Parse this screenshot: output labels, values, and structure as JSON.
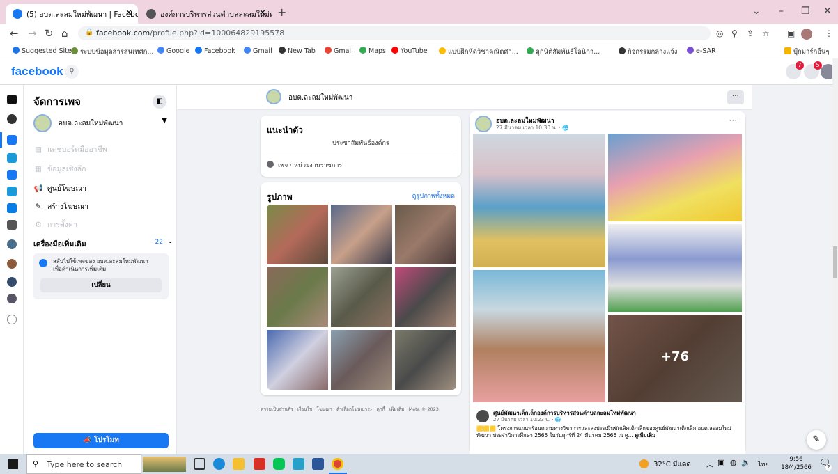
{
  "browser": {
    "tabs": [
      {
        "title": "(5) อบต.ละลมใหม่พัฒนา | Facebook",
        "active": true
      },
      {
        "title": "องค์การบริหารส่วนตำบลละลมใหม่พัฒ",
        "active": false
      }
    ],
    "url_host": "facebook.com",
    "url_path": "/profile.php?id=100064829195578",
    "bookmarks": [
      "Suggested Sites",
      "ระบบข้อมูลสารสนเทศก...",
      "Google",
      "Facebook",
      "Gmail",
      "New Tab",
      "Gmail",
      "Maps",
      "YouTube",
      "แบบฝึกหัดวิชาคณิตศา...",
      "ลูกนิติสัมพันธ์โอนิกา...",
      "กิจกรรมกลางแจ้ง",
      "e-SAR",
      "บุ๊กมาร์กอื่นๆ"
    ]
  },
  "fb": {
    "logo": "facebook",
    "notif_badges": [
      "7",
      "5"
    ]
  },
  "panel": {
    "title": "จัดการเพจ",
    "page_name": "อบต.ละลมใหม่พัฒนา",
    "items": [
      {
        "label": "แดชบอร์ดมืออาชีพ",
        "icon": "dashboard-icon",
        "dim": true
      },
      {
        "label": "ข้อมูลเชิงลึก",
        "icon": "insights-icon",
        "dim": true
      },
      {
        "label": "ศูนย์โฆษณา",
        "icon": "megaphone-icon",
        "dim": false
      },
      {
        "label": "สร้างโฆษณา",
        "icon": "edit-icon",
        "dim": false
      },
      {
        "label": "การตั้งค่า",
        "icon": "gear-icon",
        "dim": true
      }
    ],
    "tools_label": "เครื่องมือเพิ่มเติม",
    "tools_count": "22",
    "info_text_1": "สลับไปใช้เพจของ อบต.ละลมใหม่พัฒนา",
    "info_text_2": "เพื่อดำเนินการเพิ่มเติม",
    "switch_button": "เปลี่ยน",
    "promote_button": "โปรโมท"
  },
  "pagebar": {
    "name": "อบต.ละลมใหม่พัฒนา",
    "more": "···"
  },
  "intro": {
    "title": "แนะนำตัว",
    "text": "ประชาสัมพันธ์องค์กร",
    "category": "เพจ · หน่วยงานราชการ"
  },
  "photos": {
    "title": "รูปภาพ",
    "see_all": "ดูรูปภาพทั้งหมด"
  },
  "footer": "ความเป็นส่วนตัว · เงื่อนไข · โฆษณา · ตัวเลือกโฆษณา ▷ · คุกกี้ · เพิ่มเติม · Meta © 2023",
  "post": {
    "author": "อบต.ละลมใหม่พัฒนา",
    "time": "27 มีนาคม เวลา 10:30 น. · 🌐",
    "more_photos": "+76",
    "shared_author": "ศูนย์พัฒนาเด็กเล็กองค์การบริหารส่วนตำบลละลมใหม่พัฒนา",
    "shared_time": "27 มีนาคม เวลา 10:23 น. · 🌐",
    "shared_text": "โครงการแผนพร้อมความทางวิชาการและส่งประเมินขัดเลิศเด็กเล็กของศูนย์พัฒนาเด็กเล็ก อบต.ละลมใหม่พัฒนา ประจำปีการศึกษา 2565 ในวันศุกร์ที่ 24 มีนาคม 2566 ณ ศู...",
    "see_more": "ดูเพิ่มเติม"
  },
  "taskbar": {
    "search_placeholder": "Type here to search",
    "weather": "32°C มีแดด",
    "lang": "ไทย",
    "time": "9:56",
    "date": "18/4/2566",
    "notif_count": "2"
  },
  "colors": {
    "fb_blue": "#1877f2",
    "tab_bar": "#f0d5e0",
    "taskbar": "#d5dde6"
  }
}
